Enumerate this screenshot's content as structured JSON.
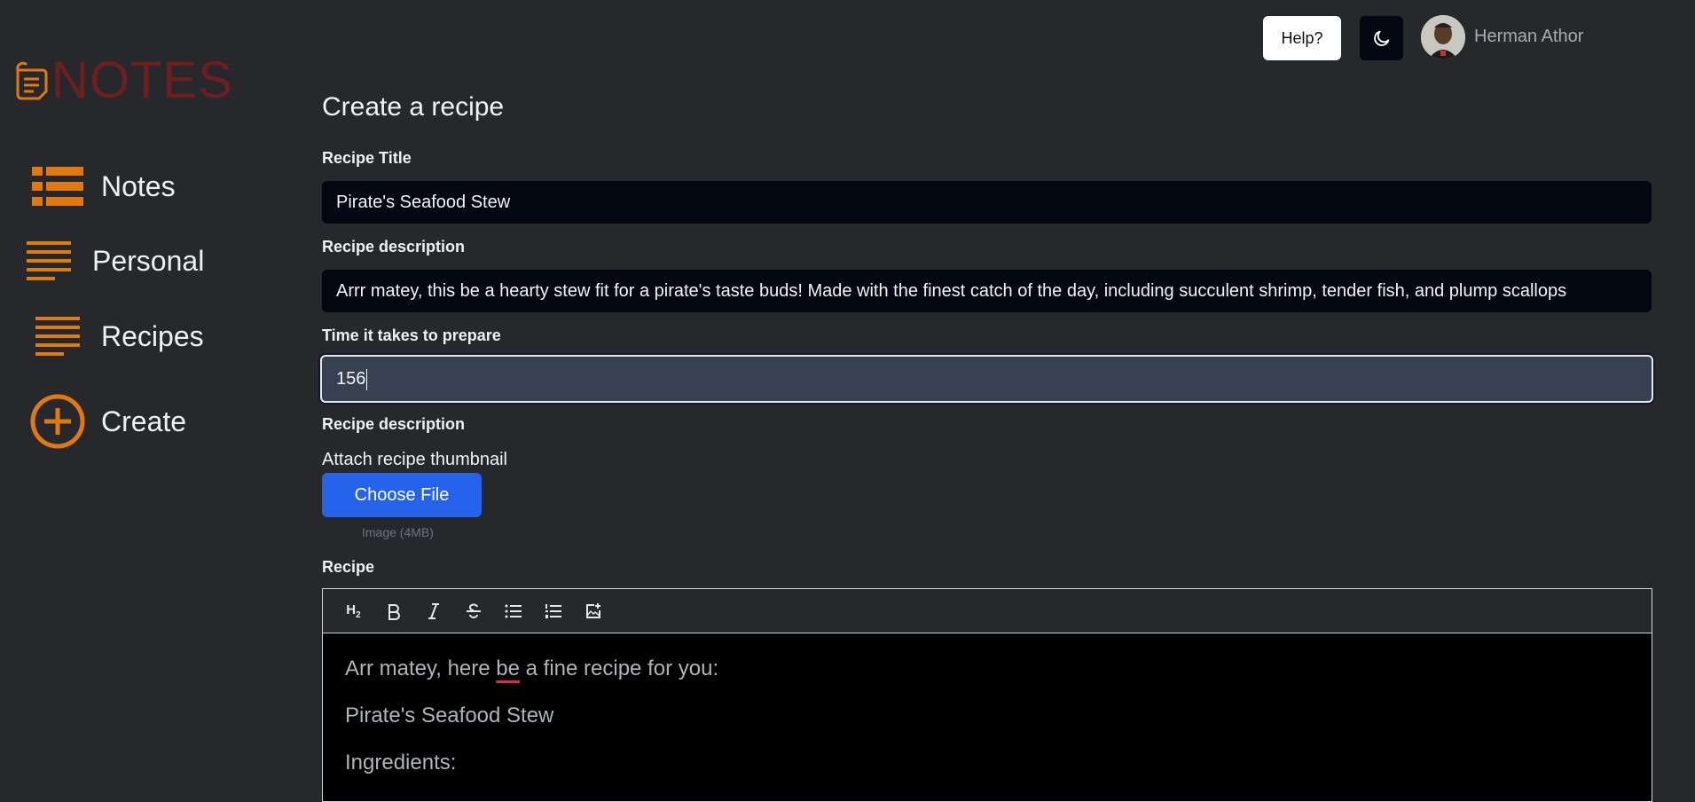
{
  "app": {
    "logo_text": "NOTES"
  },
  "colors": {
    "accent": "#e07a10",
    "logo_text": "#6b1f1f",
    "primary_button": "#2563eb"
  },
  "sidebar": {
    "items": [
      {
        "label": "Notes",
        "icon": "list-icon"
      },
      {
        "label": "Personal",
        "icon": "lines-icon"
      },
      {
        "label": "Recipes",
        "icon": "lines-icon"
      },
      {
        "label": "Create",
        "icon": "plus-circle-icon"
      }
    ]
  },
  "header": {
    "help_label": "Help?",
    "theme_icon": "moon-icon",
    "user_name": "Herman Athor"
  },
  "form": {
    "title": "Create a recipe",
    "recipe_title_label": "Recipe Title",
    "recipe_title_value": "Pirate's Seafood Stew",
    "description_label": "Recipe description",
    "description_value": "Arrr matey, this be a hearty stew fit for a pirate's taste buds! Made with the finest catch of the day, including succulent shrimp, tender fish, and plump scallops",
    "time_label": "Time it takes to prepare",
    "time_value": "156",
    "description2_label": "Recipe description",
    "attach_label": "Attach recipe thumbnail",
    "choose_file_label": "Choose File",
    "file_hint": "Image (4MB)",
    "recipe_label": "Recipe"
  },
  "editor": {
    "toolbar": [
      "heading-2-icon",
      "bold-icon",
      "italic-icon",
      "strikethrough-icon",
      "bullet-list-icon",
      "ordered-list-icon",
      "insert-image-icon"
    ],
    "lines": {
      "line1_a": "Arr matey, here ",
      "line1_b": "be",
      "line1_c": " a fine recipe for you:",
      "line2": "Pirate's Seafood Stew",
      "line3": "Ingredients:"
    }
  }
}
